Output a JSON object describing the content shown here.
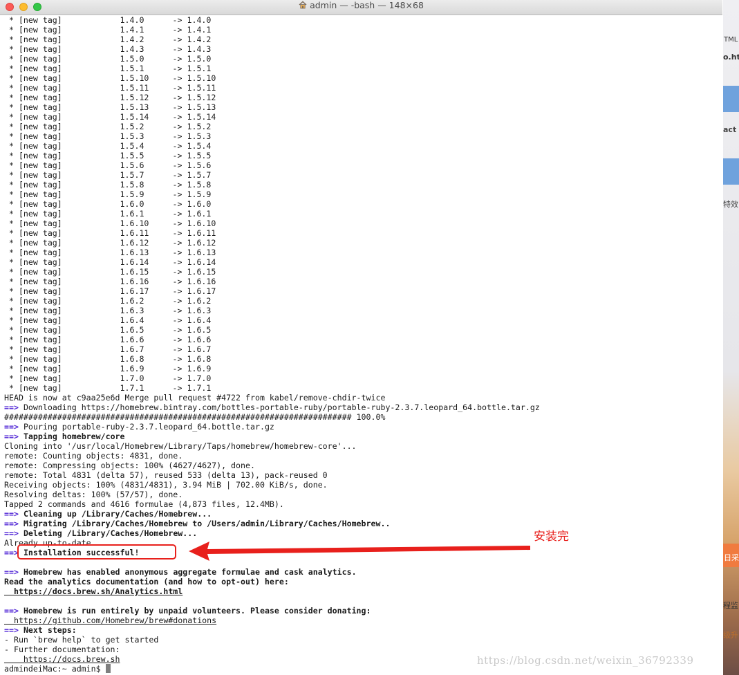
{
  "window": {
    "title": "admin — -bash — 148×68"
  },
  "tags": [
    [
      "1.4.0",
      "1.4.0"
    ],
    [
      "1.4.1",
      "1.4.1"
    ],
    [
      "1.4.2",
      "1.4.2"
    ],
    [
      "1.4.3",
      "1.4.3"
    ],
    [
      "1.5.0",
      "1.5.0"
    ],
    [
      "1.5.1",
      "1.5.1"
    ],
    [
      "1.5.10",
      "1.5.10"
    ],
    [
      "1.5.11",
      "1.5.11"
    ],
    [
      "1.5.12",
      "1.5.12"
    ],
    [
      "1.5.13",
      "1.5.13"
    ],
    [
      "1.5.14",
      "1.5.14"
    ],
    [
      "1.5.2",
      "1.5.2"
    ],
    [
      "1.5.3",
      "1.5.3"
    ],
    [
      "1.5.4",
      "1.5.4"
    ],
    [
      "1.5.5",
      "1.5.5"
    ],
    [
      "1.5.6",
      "1.5.6"
    ],
    [
      "1.5.7",
      "1.5.7"
    ],
    [
      "1.5.8",
      "1.5.8"
    ],
    [
      "1.5.9",
      "1.5.9"
    ],
    [
      "1.6.0",
      "1.6.0"
    ],
    [
      "1.6.1",
      "1.6.1"
    ],
    [
      "1.6.10",
      "1.6.10"
    ],
    [
      "1.6.11",
      "1.6.11"
    ],
    [
      "1.6.12",
      "1.6.12"
    ],
    [
      "1.6.13",
      "1.6.13"
    ],
    [
      "1.6.14",
      "1.6.14"
    ],
    [
      "1.6.15",
      "1.6.15"
    ],
    [
      "1.6.16",
      "1.6.16"
    ],
    [
      "1.6.17",
      "1.6.17"
    ],
    [
      "1.6.2",
      "1.6.2"
    ],
    [
      "1.6.3",
      "1.6.3"
    ],
    [
      "1.6.4",
      "1.6.4"
    ],
    [
      "1.6.5",
      "1.6.5"
    ],
    [
      "1.6.6",
      "1.6.6"
    ],
    [
      "1.6.7",
      "1.6.7"
    ],
    [
      "1.6.8",
      "1.6.8"
    ],
    [
      "1.6.9",
      "1.6.9"
    ],
    [
      "1.7.0",
      "1.7.0"
    ],
    [
      "1.7.1",
      "1.7.1"
    ]
  ],
  "tag_prefix": " * [new tag]",
  "tag_arrow": "->",
  "output": [
    {
      "text": "HEAD is now at c9aa25e6d Merge pull request #4722 from kabel/remove-chdir-twice"
    },
    {
      "prefix": "==>",
      "text": "Downloading https://homebrew.bintray.com/bottles-portable-ruby/portable-ruby-2.3.7.leopard_64.bottle.tar.gz"
    },
    {
      "text": "######################################################################## 100.0%"
    },
    {
      "prefix": "==>",
      "text": "Pouring portable-ruby-2.3.7.leopard_64.bottle.tar.gz"
    },
    {
      "prefix": "==>",
      "text": "Tapping homebrew/core",
      "bold": true
    },
    {
      "text": "Cloning into '/usr/local/Homebrew/Library/Taps/homebrew/homebrew-core'..."
    },
    {
      "text": "remote: Counting objects: 4831, done."
    },
    {
      "text": "remote: Compressing objects: 100% (4627/4627), done."
    },
    {
      "text": "remote: Total 4831 (delta 57), reused 533 (delta 13), pack-reused 0"
    },
    {
      "text": "Receiving objects: 100% (4831/4831), 3.94 MiB | 702.00 KiB/s, done."
    },
    {
      "text": "Resolving deltas: 100% (57/57), done."
    },
    {
      "text": "Tapped 2 commands and 4616 formulae (4,873 files, 12.4MB)."
    },
    {
      "prefix": "==>",
      "text": "Cleaning up /Library/Caches/Homebrew...",
      "bold": true
    },
    {
      "prefix": "==>",
      "text": "Migrating /Library/Caches/Homebrew to /Users/admin/Library/Caches/Homebrew..",
      "bold": true
    },
    {
      "prefix": "==>",
      "text": "Deleting /Library/Caches/Homebrew...",
      "bold": true
    },
    {
      "text": "Already up-to-date."
    },
    {
      "prefix": "==>",
      "text": "Installation successful!",
      "bold": true
    },
    {
      "text": ""
    },
    {
      "prefix": "==>",
      "text": "Homebrew has enabled anonymous aggregate formulae and cask analytics.",
      "bold": true
    },
    {
      "text": "Read the analytics documentation (and how to opt-out) here:",
      "bold": true
    },
    {
      "text": "  https://docs.brew.sh/Analytics.html",
      "bold": true,
      "link": true
    },
    {
      "text": ""
    },
    {
      "prefix": "==>",
      "text": "Homebrew is run entirely by unpaid volunteers. Please consider donating:",
      "bold": true
    },
    {
      "text": "  https://github.com/Homebrew/brew#donations",
      "link": true
    },
    {
      "prefix": "==>",
      "text": "Next steps:",
      "bold": true
    },
    {
      "text": "- Run `brew help` to get started"
    },
    {
      "text": "- Further documentation:"
    },
    {
      "text": "    https://docs.brew.sh",
      "link": true
    },
    {
      "text": "admindeiMac:~ admin$ ",
      "cursor": true
    }
  ],
  "annotation": {
    "label": "安装完",
    "color": "#e8201c"
  },
  "watermark": "https://blog.csdn.net/weixin_36792339",
  "side_texts": [
    "TML",
    "o.ht",
    "act",
    "特效",
    "日采",
    "程监",
    "级升"
  ]
}
